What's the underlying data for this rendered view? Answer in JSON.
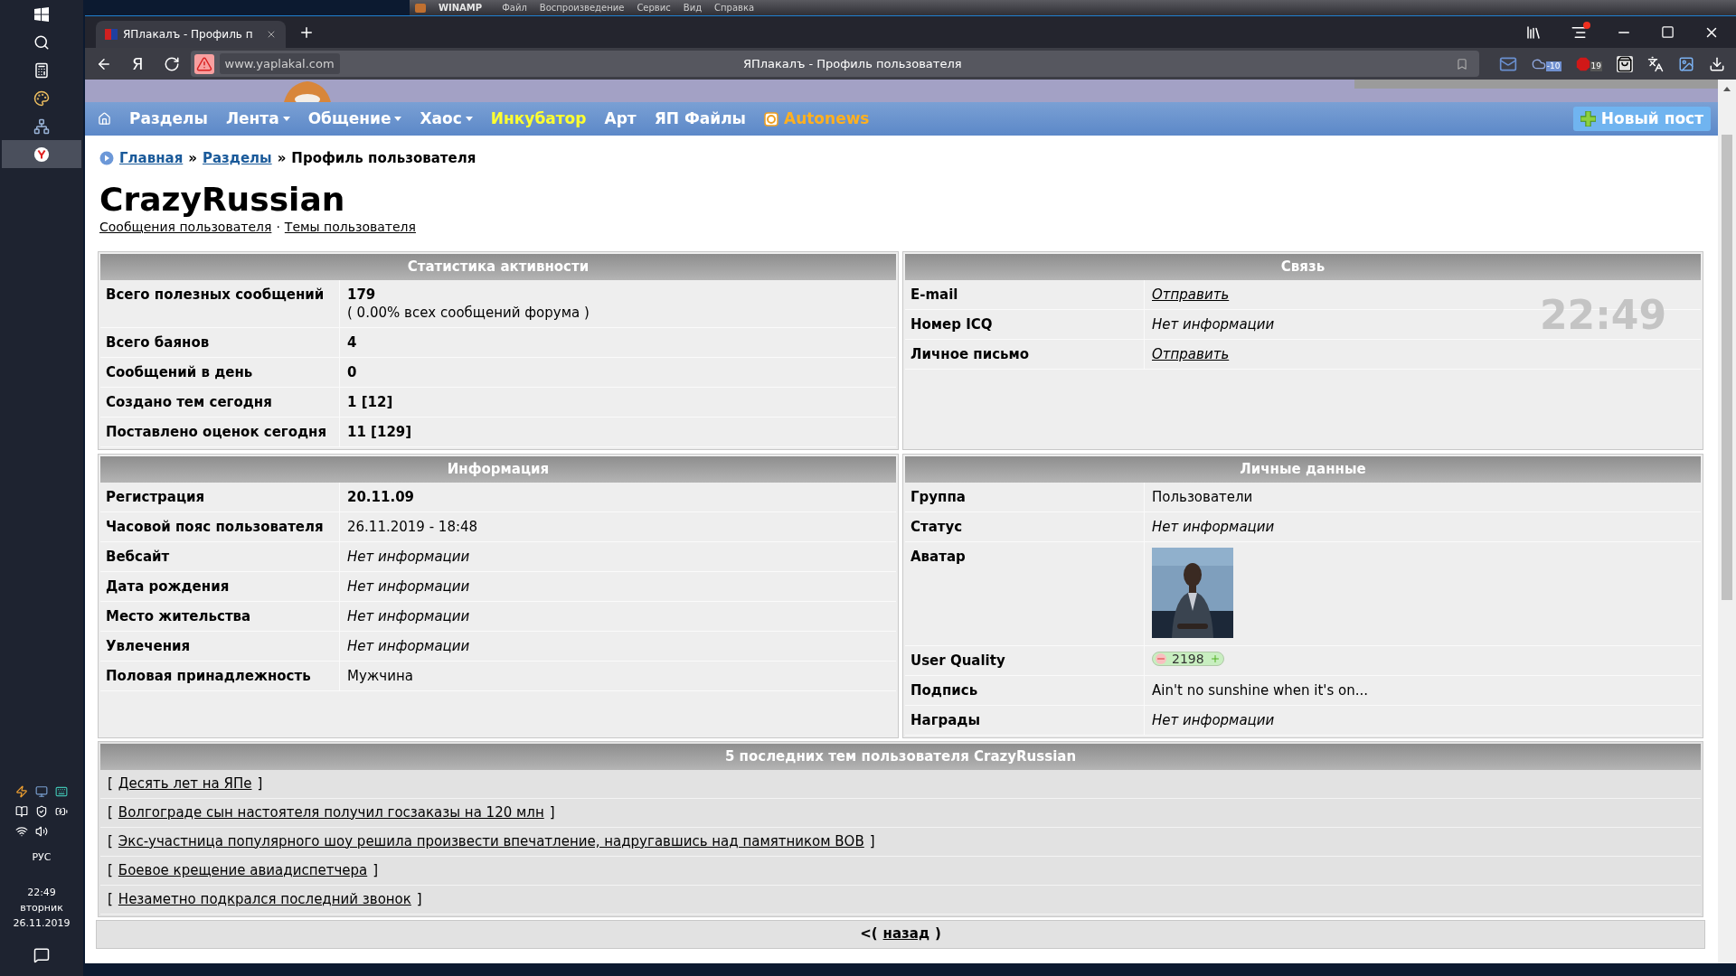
{
  "taskbar": {
    "apps": [
      {
        "kind": "windows",
        "selected": false
      },
      {
        "kind": "search",
        "selected": false
      },
      {
        "kind": "calculator",
        "selected": false
      },
      {
        "kind": "paint",
        "selected": false
      },
      {
        "kind": "network",
        "selected": false
      },
      {
        "kind": "browser",
        "selected": true
      }
    ],
    "language": "РУС",
    "time": "22:49",
    "weekday": "вторник",
    "date": "26.11.2019"
  },
  "winamp": {
    "title": "WINAMP",
    "menu": [
      "Файл",
      "Воспроизведение",
      "Сервис",
      "Вид",
      "Справка"
    ]
  },
  "browser": {
    "tab_title": "ЯПлакалъ - Профиль п",
    "home_button": "Я",
    "address": "www.yaplakal.com",
    "page_title": "ЯПлакалъ - Профиль пользователя",
    "cloud_badge": "-10",
    "adblock_badge": "19"
  },
  "nav": {
    "items": [
      {
        "label": "Разделы",
        "kind": "link"
      },
      {
        "label": "Лента",
        "kind": "menu"
      },
      {
        "label": "Общение",
        "kind": "menu"
      },
      {
        "label": "Хаос",
        "kind": "menu"
      },
      {
        "label": "Инкубатор",
        "kind": "featured"
      },
      {
        "label": "Арт",
        "kind": "link"
      },
      {
        "label": "ЯП Файлы",
        "kind": "link"
      },
      {
        "label": "Autonews",
        "kind": "partner"
      }
    ],
    "new_post": "Новый пост"
  },
  "breadcrumb": [
    {
      "label": "Главная",
      "link": true
    },
    {
      "label": "»",
      "link": false
    },
    {
      "label": "Разделы",
      "link": true
    },
    {
      "label": "»",
      "link": false
    },
    {
      "label": "Профиль пользователя",
      "link": false
    }
  ],
  "profile": {
    "name": "CrazyRussian",
    "links": [
      "Сообщения пользователя",
      "Темы пользователя"
    ],
    "separator": "·"
  },
  "clock_overlay": "22:49",
  "panels": [
    {
      "title": "Статистика активности",
      "rows": [
        {
          "label": "Всего полезных сообщений",
          "value": "179",
          "note": "( 0.00% всех сообщений форума )",
          "kind": "bold"
        },
        {
          "label": "Всего баянов",
          "value": "4",
          "kind": "bold"
        },
        {
          "label": "Сообщений в день",
          "value": "0",
          "kind": "bold"
        },
        {
          "label": "Создано тем сегодня",
          "value": "1 [12]",
          "kind": "bold"
        },
        {
          "label": "Поставлено оценок сегодня",
          "value": "11 [129]",
          "kind": "bold"
        }
      ]
    },
    {
      "title": "Связь",
      "rows": [
        {
          "label": "E-mail",
          "value": "Отправить",
          "kind": "link"
        },
        {
          "label": "Номер ICQ",
          "value": "Нет информации",
          "kind": "italic"
        },
        {
          "label": "Личное письмо",
          "value": "Отправить",
          "kind": "link"
        }
      ]
    },
    {
      "title": "Информация",
      "rows": [
        {
          "label": "Регистрация",
          "value": "20.11.09",
          "kind": "bold"
        },
        {
          "label": "Часовой пояс пользователя",
          "value": "26.11.2019 - 18:48",
          "kind": "plain"
        },
        {
          "label": "Вебсайт",
          "value": "Нет информации",
          "kind": "italic"
        },
        {
          "label": "Дата рождения",
          "value": "Нет информации",
          "kind": "italic"
        },
        {
          "label": "Место жительства",
          "value": "Нет информации",
          "kind": "italic"
        },
        {
          "label": "Увлечения",
          "value": "Нет информации",
          "kind": "italic"
        },
        {
          "label": "Половая принадлежность",
          "value": "Мужчина",
          "kind": "plain"
        }
      ]
    },
    {
      "title": "Личные данные",
      "rows": [
        {
          "label": "Группа",
          "value": "Пользователи",
          "kind": "plain"
        },
        {
          "label": "Статус",
          "value": "Нет информации",
          "kind": "italic"
        },
        {
          "label": "Аватар",
          "kind": "picture"
        },
        {
          "label": "User Quality",
          "value": "2198",
          "kind": "rating"
        },
        {
          "label": "Подпись",
          "value": "Ain't no sunshine when it's on...",
          "kind": "plain"
        },
        {
          "label": "Награды",
          "value": "Нет информации",
          "kind": "italic"
        }
      ]
    }
  ],
  "recent_topics": {
    "title": "5 последних тем пользователя CrazyRussian",
    "open": "[",
    "close": "]",
    "topics": [
      "Десять лет на ЯПе",
      "Волгограде сын настоятеля получил госзаказы на 120 млн",
      "Экс-участница популярного шоу решила произвести впечатление, надругавшись над памятником ВОВ",
      "Боевое крещение авиадиспетчера",
      "Незаметно подкрался последний звонок"
    ]
  },
  "back": {
    "open": "<(",
    "link": "назад",
    "close": ")"
  }
}
